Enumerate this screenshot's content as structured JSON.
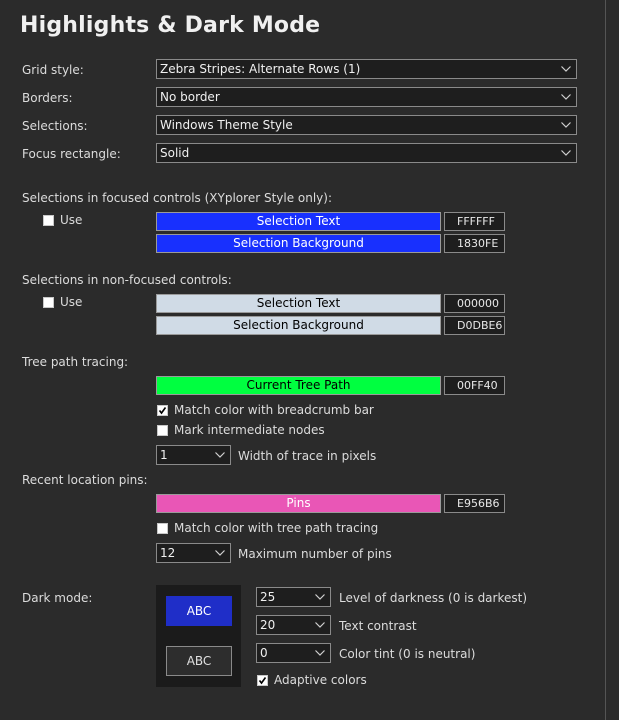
{
  "title": "Highlights & Dark Mode",
  "grid_style": {
    "label": "Grid style:",
    "value": "Zebra Stripes: Alternate Rows (1)"
  },
  "borders": {
    "label": "Borders:",
    "value": "No border"
  },
  "selections": {
    "label": "Selections:",
    "value": "Windows Theme Style"
  },
  "focus_rect": {
    "label": "Focus rectangle:",
    "value": "Solid"
  },
  "focused": {
    "heading": "Selections in focused controls (XYplorer Style only):",
    "use_label": "Use",
    "use_checked": false,
    "text_label": "Selection Text",
    "text_hex": "FFFFFF",
    "text_color": "#1830FE",
    "bg_label": "Selection Background",
    "bg_hex": "1830FE",
    "bg_color": "#1830FE"
  },
  "nonfocused": {
    "heading": "Selections in non-focused controls:",
    "use_label": "Use",
    "use_checked": false,
    "text_label": "Selection Text",
    "text_hex": "000000",
    "text_color": "#D0DBE6",
    "bg_label": "Selection Background",
    "bg_hex": "D0DBE6",
    "bg_color": "#D0DBE6"
  },
  "tree": {
    "heading": "Tree path tracing:",
    "current_label": "Current Tree Path",
    "current_hex": "00FF40",
    "current_color": "#00FF40",
    "match_breadcrumb": "Match color with breadcrumb bar",
    "match_breadcrumb_checked": true,
    "mark_intermediate": "Mark intermediate nodes",
    "mark_intermediate_checked": false,
    "width_value": "1",
    "width_label": "Width of trace in pixels"
  },
  "pins": {
    "heading": "Recent location pins:",
    "pins_label": "Pins",
    "pins_hex": "E956B6",
    "pins_color": "#E956B6",
    "match_tree": "Match color with tree path tracing",
    "match_tree_checked": false,
    "max_value": "12",
    "max_label": "Maximum number of pins"
  },
  "dark": {
    "heading": "Dark mode:",
    "preview_selected": "ABC",
    "preview_normal": "ABC",
    "darkness_value": "25",
    "darkness_label": "Level of darkness (0 is darkest)",
    "contrast_value": "20",
    "contrast_label": "Text contrast",
    "tint_value": "0",
    "tint_label": "Color tint (0 is neutral)",
    "adaptive_label": "Adaptive colors",
    "adaptive_checked": true
  },
  "colors": {
    "background": "#2B2B2B",
    "accent_blue": "#1830FE",
    "preview_selected": "#1F2EC8"
  }
}
